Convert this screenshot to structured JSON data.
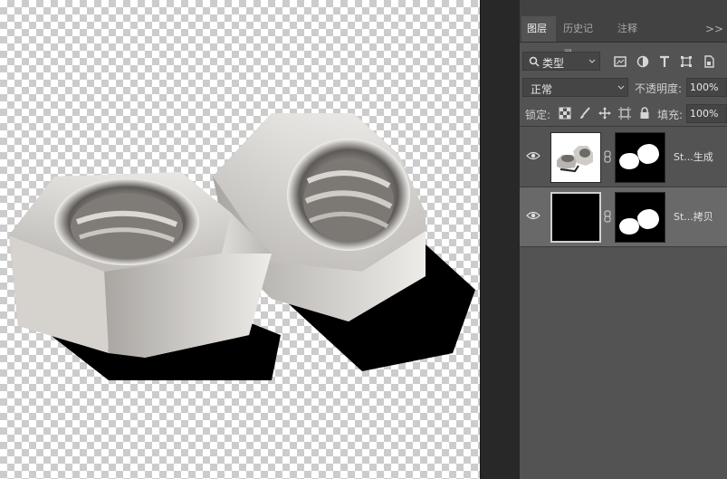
{
  "panel": {
    "tabs": [
      {
        "label": "图层",
        "active": true
      },
      {
        "label": "历史记录",
        "active": false
      },
      {
        "label": "注释",
        "active": false
      }
    ],
    "menu_glyph": ">>",
    "filter": {
      "label": "类型"
    },
    "blend": {
      "mode": "正常",
      "opacity_label": "不透明度:",
      "opacity_value": "100%"
    },
    "lock": {
      "label": "锁定:",
      "fill_label": "填充:",
      "fill_value": "100%"
    },
    "layers": [
      {
        "name": "St...生成",
        "selected": false,
        "thumb_fill": "#ffffff"
      },
      {
        "name": "St...拷贝",
        "selected": true,
        "thumb_fill": "#000000"
      }
    ]
  },
  "colors": {
    "panel_bg": "#535353",
    "tab_bar": "#424242",
    "selected_layer": "#696969",
    "gutter": "#282828"
  }
}
